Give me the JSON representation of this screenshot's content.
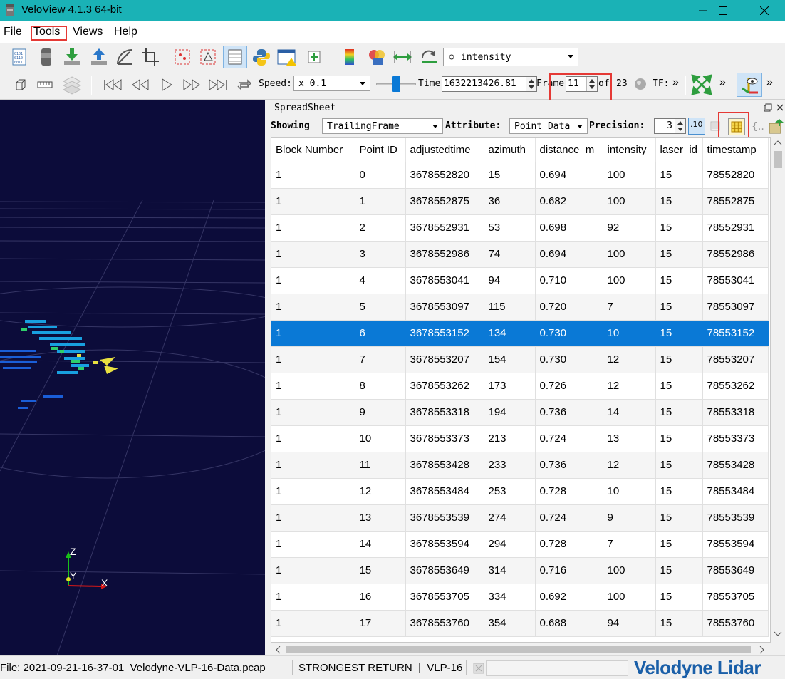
{
  "window": {
    "title": "VeloView 4.1.3 64-bit"
  },
  "menu": {
    "file": "File",
    "tools": "Tools",
    "views": "Views",
    "help": "Help"
  },
  "toolbar1": {
    "color_by": "intensity"
  },
  "toolbar2": {
    "speed_label": "Speed:",
    "speed_value": "x 0.1",
    "time_label": "Time",
    "time_value": "1632213426.81",
    "frame_label": "Frame",
    "frame_value": "11",
    "of_label": "of",
    "total_frames": "23",
    "tf_label": "TF:",
    "more": "»"
  },
  "axes": {
    "z": "Z",
    "y": "Y",
    "x": "X"
  },
  "spreadsheet": {
    "title": "SpreadSheet",
    "showing_label": "Showing",
    "showing_value": "TrailingFrame",
    "attribute_label": "Attribute:",
    "attribute_value": "Point Data",
    "precision_label": "Precision:",
    "precision_value": "3",
    "precision_btn": ".10",
    "columns": [
      "Block Number",
      "Point ID",
      "adjustedtime",
      "azimuth",
      "distance_m",
      "intensity",
      "laser_id",
      "timestamp"
    ],
    "selected_row": 6,
    "rows": [
      [
        "1",
        "0",
        "3678552820",
        "15",
        "0.694",
        "100",
        "15",
        "78552820"
      ],
      [
        "1",
        "1",
        "3678552875",
        "36",
        "0.682",
        "100",
        "15",
        "78552875"
      ],
      [
        "1",
        "2",
        "3678552931",
        "53",
        "0.698",
        "92",
        "15",
        "78552931"
      ],
      [
        "1",
        "3",
        "3678552986",
        "74",
        "0.694",
        "100",
        "15",
        "78552986"
      ],
      [
        "1",
        "4",
        "3678553041",
        "94",
        "0.710",
        "100",
        "15",
        "78553041"
      ],
      [
        "1",
        "5",
        "3678553097",
        "115",
        "0.720",
        "7",
        "15",
        "78553097"
      ],
      [
        "1",
        "6",
        "3678553152",
        "134",
        "0.730",
        "10",
        "15",
        "78553152"
      ],
      [
        "1",
        "7",
        "3678553207",
        "154",
        "0.730",
        "12",
        "15",
        "78553207"
      ],
      [
        "1",
        "8",
        "3678553262",
        "173",
        "0.726",
        "12",
        "15",
        "78553262"
      ],
      [
        "1",
        "9",
        "3678553318",
        "194",
        "0.736",
        "14",
        "15",
        "78553318"
      ],
      [
        "1",
        "10",
        "3678553373",
        "213",
        "0.724",
        "13",
        "15",
        "78553373"
      ],
      [
        "1",
        "11",
        "3678553428",
        "233",
        "0.736",
        "12",
        "15",
        "78553428"
      ],
      [
        "1",
        "12",
        "3678553484",
        "253",
        "0.728",
        "10",
        "15",
        "78553484"
      ],
      [
        "1",
        "13",
        "3678553539",
        "274",
        "0.724",
        "9",
        "15",
        "78553539"
      ],
      [
        "1",
        "14",
        "3678553594",
        "294",
        "0.728",
        "7",
        "15",
        "78553594"
      ],
      [
        "1",
        "15",
        "3678553649",
        "314",
        "0.716",
        "100",
        "15",
        "78553649"
      ],
      [
        "1",
        "16",
        "3678553705",
        "334",
        "0.692",
        "100",
        "15",
        "78553705"
      ],
      [
        "1",
        "17",
        "3678553760",
        "354",
        "0.688",
        "94",
        "15",
        "78553760"
      ]
    ]
  },
  "status": {
    "file": "File: 2021-09-21-16-37-01_Velodyne-VLP-16-Data.pcap",
    "mode": "STRONGEST RETURN  |  VLP-16",
    "brand": "Velodyne Lidar"
  },
  "colors": {
    "titlebar": "#1ab2b6",
    "selection": "#0a79d6",
    "view_bg": "#0c0c3a",
    "highlight": "#e53935"
  }
}
